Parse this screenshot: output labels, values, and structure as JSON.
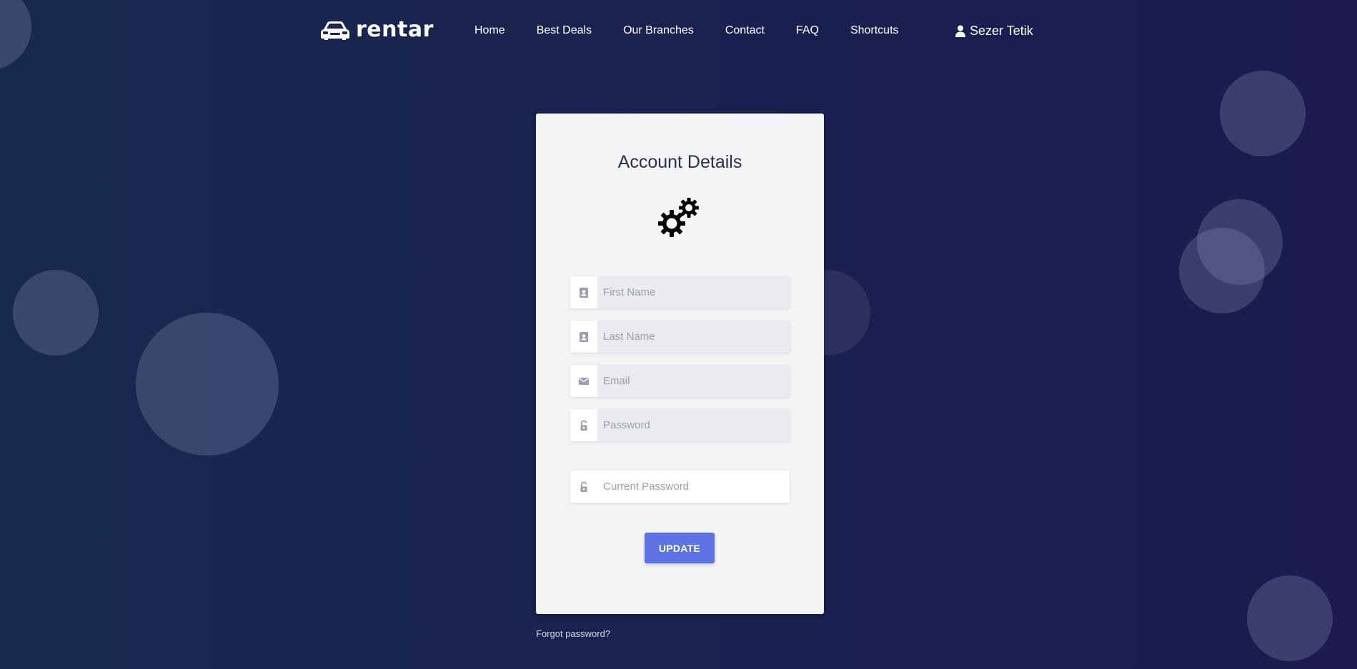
{
  "brand": {
    "name": "rentar",
    "logo_icon": "car-icon"
  },
  "nav": {
    "items": [
      {
        "label": "Home"
      },
      {
        "label": "Best Deals"
      },
      {
        "label": "Our Branches"
      },
      {
        "label": "Contact"
      },
      {
        "label": "FAQ"
      },
      {
        "label": "Shortcuts"
      }
    ],
    "user": {
      "name": "Sezer Tetik",
      "icon": "user-icon"
    }
  },
  "card": {
    "title": "Account Details",
    "icon": "gears-icon",
    "fields": {
      "first_name": {
        "placeholder": "First Name",
        "value": "",
        "icon": "contact-card-icon"
      },
      "last_name": {
        "placeholder": "Last Name",
        "value": "",
        "icon": "contact-card-icon"
      },
      "email": {
        "placeholder": "Email",
        "value": "",
        "icon": "envelope-icon"
      },
      "password": {
        "placeholder": "Password",
        "value": "",
        "icon": "unlock-icon"
      },
      "current_password": {
        "placeholder": "Current Password",
        "value": "",
        "icon": "unlock-icon"
      }
    },
    "update_label": "UPDATE"
  },
  "forgot_password": "Forgot password?",
  "colors": {
    "background_start": "#172a4d",
    "background_end": "#1d1a4f",
    "card": "#f3f4f6",
    "button": "#5f72e4",
    "title": "#2b2f4a"
  }
}
